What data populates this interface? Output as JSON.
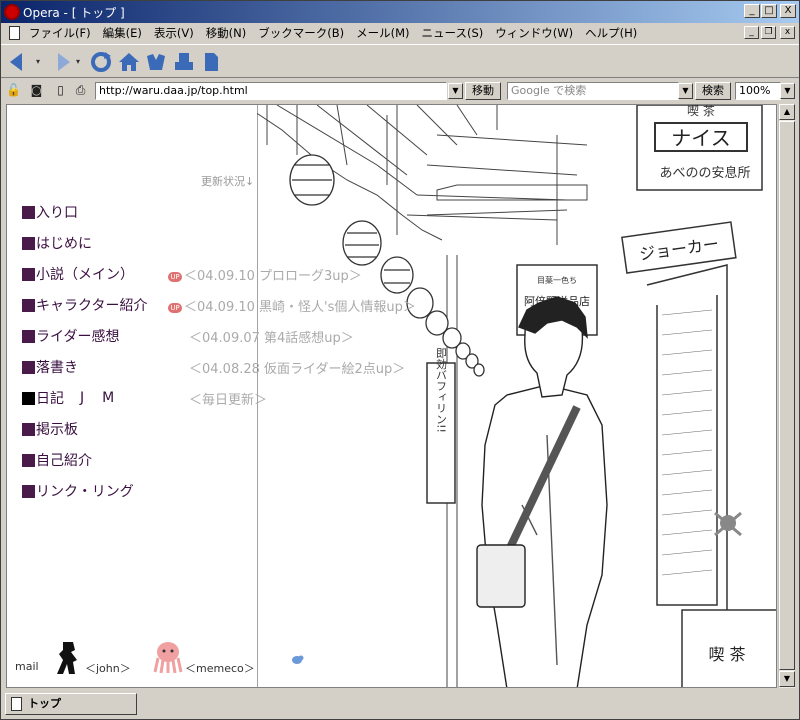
{
  "window": {
    "title": "Opera - [ トップ ]",
    "buttons": {
      "minimize": "_",
      "maximize": "□",
      "close": "X"
    }
  },
  "menu": {
    "items": [
      "ファイル(F)",
      "編集(E)",
      "表示(V)",
      "移動(N)",
      "ブックマーク(B)",
      "メール(M)",
      "ニュース(S)",
      "ウィンドウ(W)",
      "ヘルプ(H)"
    ]
  },
  "toolbar": {
    "icons": [
      "back-icon",
      "forward-icon",
      "reload-icon",
      "home-icon",
      "hotlist-icon",
      "print-icon",
      "page-icon"
    ]
  },
  "address": {
    "url": "http://waru.daa.jp/top.html",
    "go_label": "移動",
    "search_placeholder": "Google で検索",
    "search_button": "検索",
    "zoom": "100%"
  },
  "page": {
    "update_label": "更新状況↓",
    "nav": [
      {
        "label": "入り口"
      },
      {
        "label": "はじめに"
      },
      {
        "label": "小説（メイン）",
        "update": "＜04.09.10  プロローグ3up＞",
        "new_badge": "UP"
      },
      {
        "label": "キャラクター紹介",
        "update": "＜04.09.10 黒崎・怪人's個人情報up＞",
        "new_badge": "UP"
      },
      {
        "label": "ライダー感想",
        "update": "＜04.09.07  第4話感想up＞"
      },
      {
        "label": "落書き",
        "update": "＜04.08.28 仮面ライダー絵2点up＞"
      },
      {
        "label": "日記",
        "j": "J",
        "m": "M",
        "update": "＜毎日更新＞"
      },
      {
        "label": "掲示板"
      },
      {
        "label": "自己紹介"
      },
      {
        "label": "リンク・リング"
      }
    ],
    "illustration": {
      "sign_top": "喫 茶",
      "sign_nice": "ナイス",
      "sign_abe": "あべのの安息所",
      "sign_shop": "阿倍野洋品店",
      "sign_shop_small": "目薬一色ち",
      "sign_bafirin": "即効バフィリン!!",
      "sign_camera": "ジョーカー",
      "sign_kissa": "喫 茶"
    },
    "footer": {
      "mail": "mail",
      "john": "＜john＞",
      "memeco": "＜memeco＞"
    }
  },
  "status": {
    "tab_label": "トップ"
  }
}
